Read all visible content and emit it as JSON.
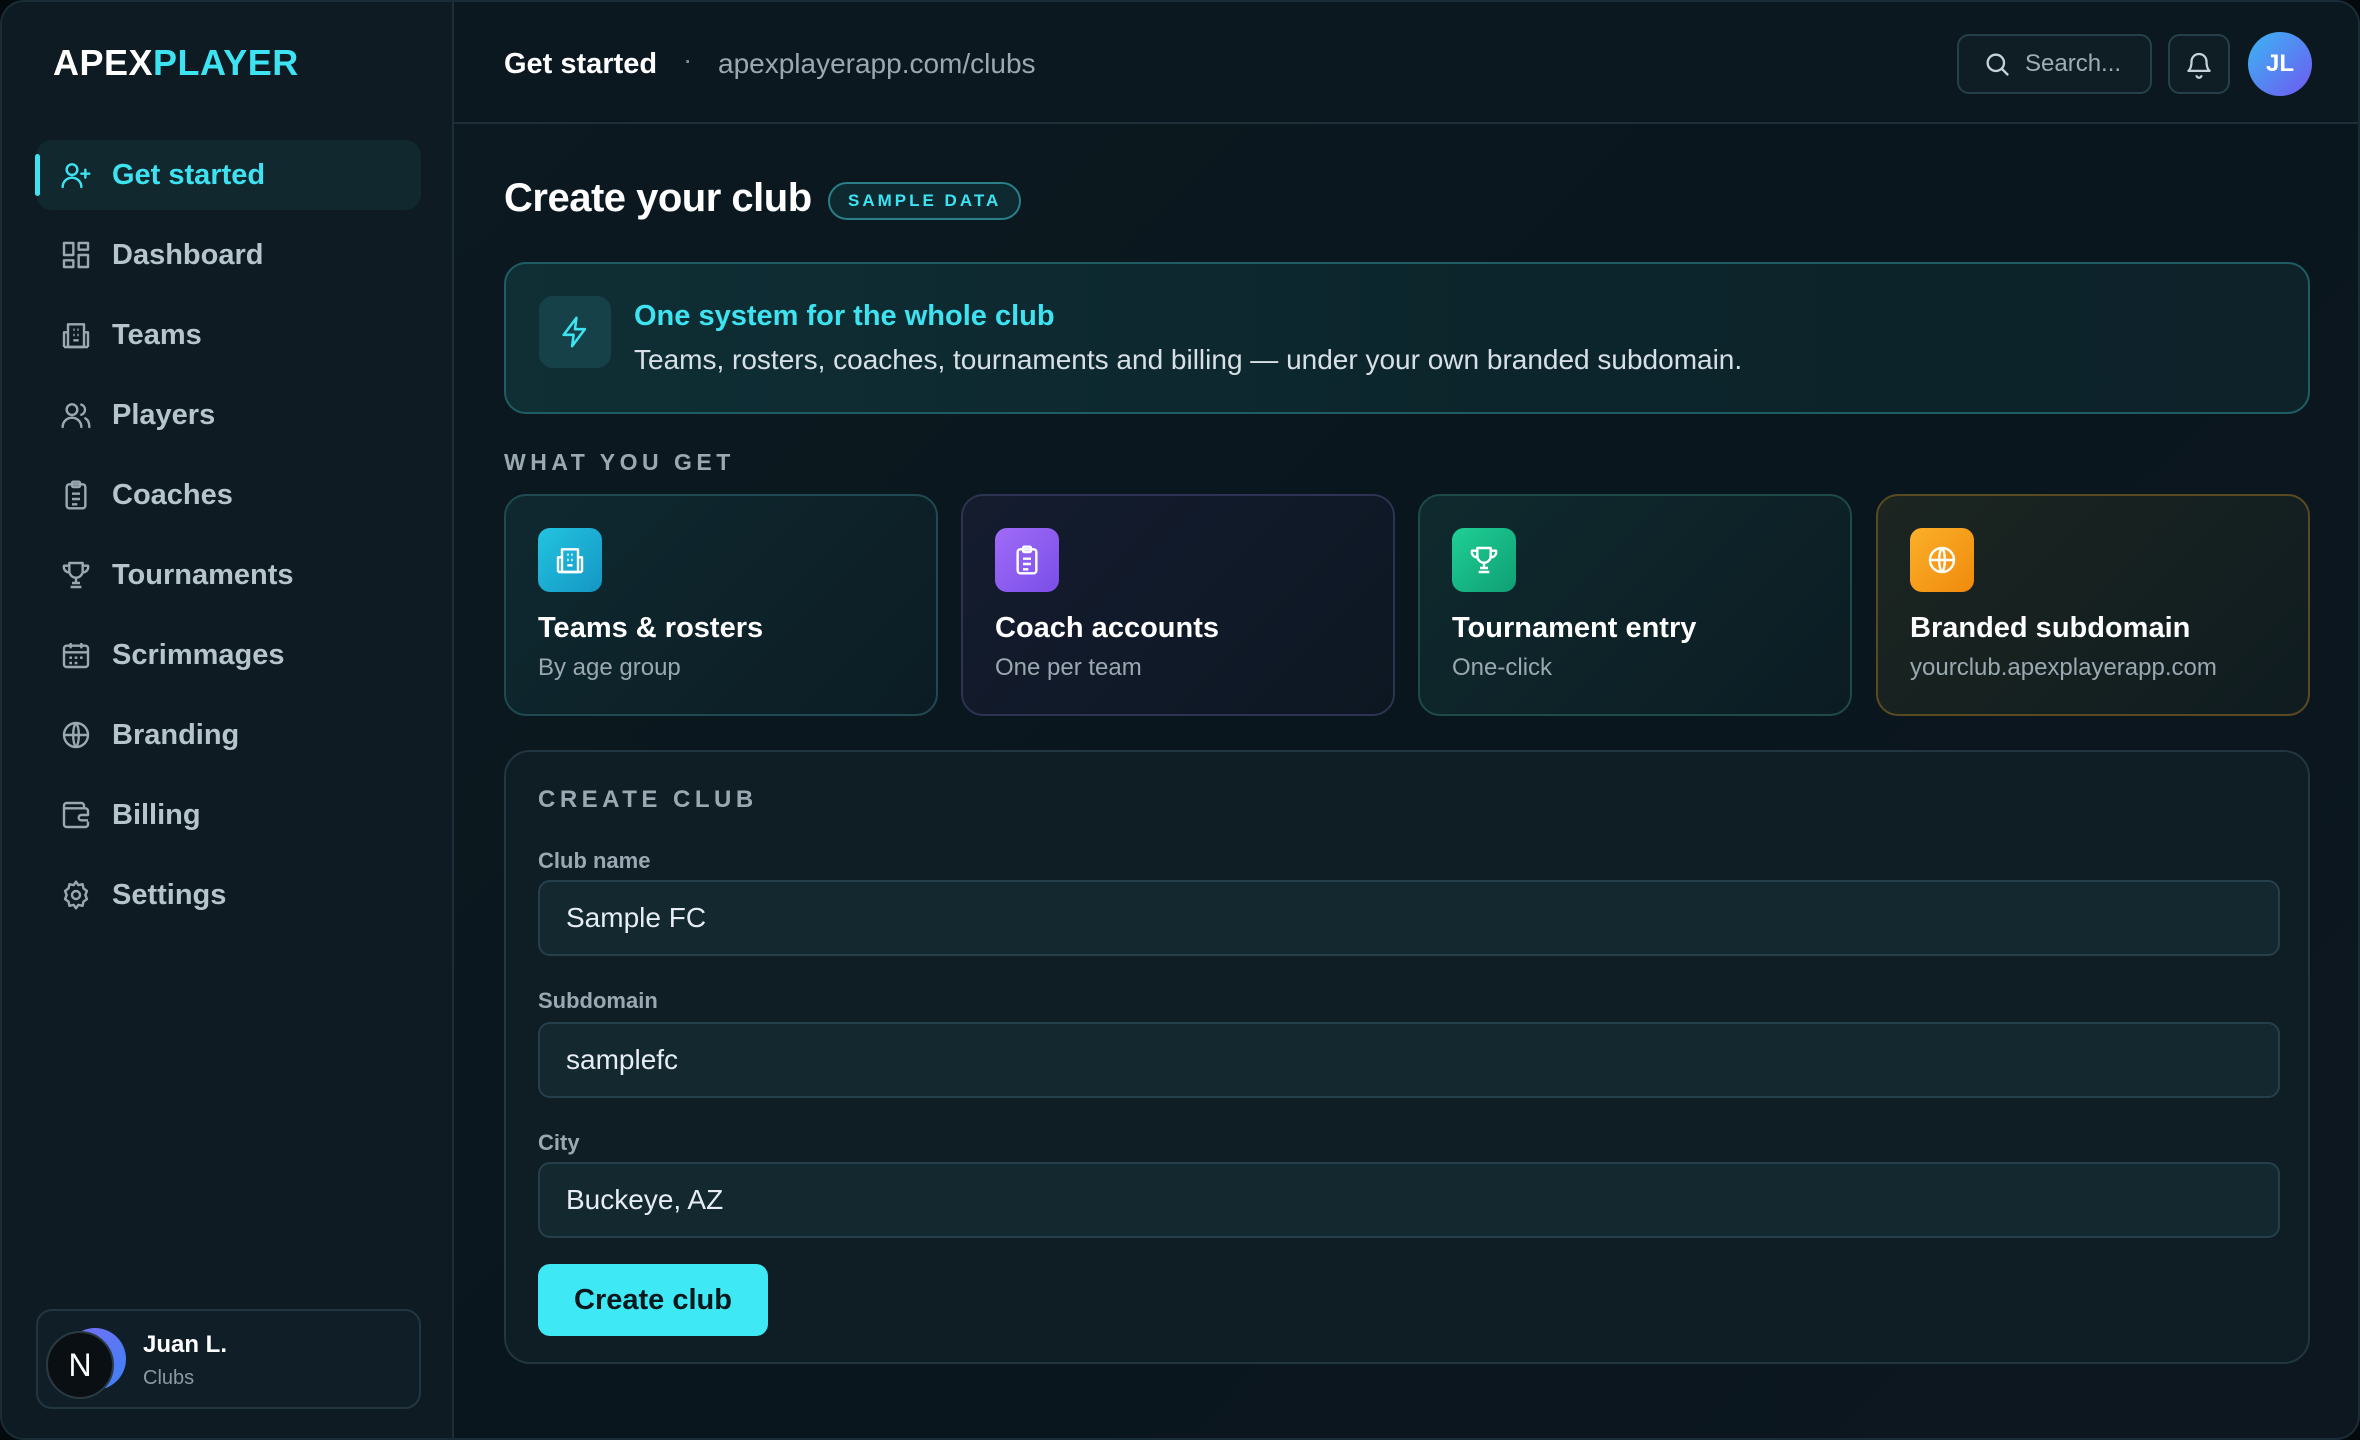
{
  "brand": {
    "part1": "APEX",
    "part2": "PLAYER"
  },
  "sidebar": {
    "items": [
      {
        "label": "Get started",
        "icon": "user-plus-icon",
        "active": true
      },
      {
        "label": "Dashboard",
        "icon": "dashboard-icon"
      },
      {
        "label": "Teams",
        "icon": "building-icon"
      },
      {
        "label": "Players",
        "icon": "users-icon"
      },
      {
        "label": "Coaches",
        "icon": "clipboard-icon"
      },
      {
        "label": "Tournaments",
        "icon": "trophy-icon"
      },
      {
        "label": "Scrimmages",
        "icon": "calendar-icon"
      },
      {
        "label": "Branding",
        "icon": "globe-icon"
      },
      {
        "label": "Billing",
        "icon": "wallet-icon"
      },
      {
        "label": "Settings",
        "icon": "gear-icon"
      }
    ],
    "user": {
      "initial": "N",
      "name": "Juan L.",
      "role": "Clubs"
    }
  },
  "header": {
    "title": "Get started",
    "separator": "·",
    "url": "apexplayerapp.com/clubs",
    "search_placeholder": "Search...",
    "avatar_initials": "JL"
  },
  "page": {
    "title": "Create your club",
    "badge": "SAMPLE DATA",
    "banner": {
      "title": "One system for the whole club",
      "description": "Teams, rosters, coaches, tournaments and billing — under your own branded subdomain."
    },
    "section_label": "WHAT YOU GET",
    "features": [
      {
        "title": "Teams & rosters",
        "subtitle": "By age group",
        "icon": "building-icon",
        "color": "#1bb7d6"
      },
      {
        "title": "Coach accounts",
        "subtitle": "One per team",
        "icon": "clipboard-icon",
        "color": "#8b5cf6"
      },
      {
        "title": "Tournament entry",
        "subtitle": "One-click",
        "icon": "trophy-icon",
        "color": "#16b886"
      },
      {
        "title": "Branded subdomain",
        "subtitle": "yourclub.apexplayerapp.com",
        "icon": "globe-icon",
        "color": "#f59e0b"
      }
    ],
    "form": {
      "heading": "CREATE CLUB",
      "fields": [
        {
          "label": "Club name",
          "value": "Sample FC"
        },
        {
          "label": "Subdomain",
          "value": "samplefc"
        },
        {
          "label": "City",
          "value": "Buckeye, AZ"
        }
      ],
      "submit_label": "Create club"
    }
  },
  "colors": {
    "accent": "#3ee3f2",
    "background": "#0a161d",
    "sidebar": "#0e1b22"
  }
}
